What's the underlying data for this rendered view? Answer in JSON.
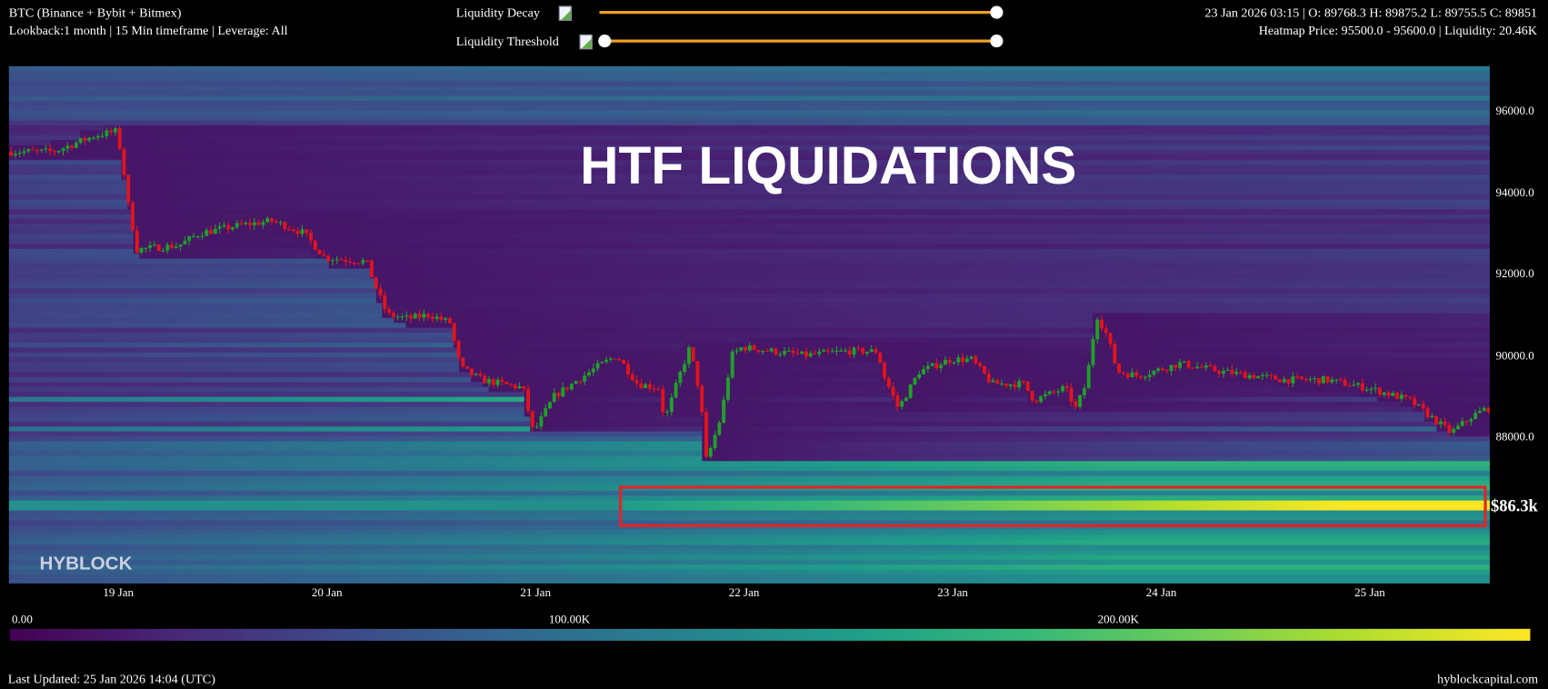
{
  "header": {
    "title": "BTC (Binance + Bybit + Bitmex)",
    "subtitle": "Lookback:1 month | 15 Min timeframe | Leverage: All",
    "ohlc": "23 Jan 2026 03:15 | O: 89768.3 H: 89875.2 L: 89755.5 C: 89851",
    "hover": "Heatmap Price: 95500.0 - 95600.0 | Liquidity: 20.46K"
  },
  "controls": {
    "decay_label": "Liquidity Decay",
    "decay_value": 1.0,
    "threshold_label": "Liquidity Threshold",
    "threshold_value": 0.0,
    "slider_color": "#f0a020"
  },
  "chart_data": {
    "type": "heatmap",
    "title": "HTF LIQUIDATIONS",
    "watermark": "HYBLOCK",
    "yticks": [
      96000,
      94000,
      92000,
      90000,
      88000
    ],
    "ytick_labels": [
      "96000.0",
      "94000.0",
      "92000.0",
      "90000.0",
      "88000.0"
    ],
    "ylim": [
      84400,
      97100
    ],
    "xtick_labels": [
      "19 Jan",
      "20 Jan",
      "21 Jan",
      "22 Jan",
      "23 Jan",
      "24 Jan",
      "25 Jan"
    ],
    "xlim_days_from_19_jan": [
      -0.525,
      6.575
    ],
    "price_path": [
      [
        -0.52,
        95000
      ],
      [
        -0.3,
        95000
      ],
      [
        -0.1,
        95400
      ],
      [
        0,
        95500
      ],
      [
        0.03,
        94800
      ],
      [
        0.05,
        93900
      ],
      [
        0.1,
        92600
      ],
      [
        0.3,
        92700
      ],
      [
        0.4,
        93000
      ],
      [
        0.6,
        93200
      ],
      [
        0.75,
        93300
      ],
      [
        0.9,
        93000
      ],
      [
        1.0,
        92400
      ],
      [
        1.2,
        92300
      ],
      [
        1.25,
        91600
      ],
      [
        1.3,
        91000
      ],
      [
        1.4,
        90900
      ],
      [
        1.5,
        91000
      ],
      [
        1.6,
        90800
      ],
      [
        1.65,
        89700
      ],
      [
        1.75,
        89400
      ],
      [
        1.85,
        89300
      ],
      [
        1.95,
        89200
      ],
      [
        2.0,
        88100
      ],
      [
        2.1,
        89000
      ],
      [
        2.3,
        89700
      ],
      [
        2.4,
        90000
      ],
      [
        2.5,
        89300
      ],
      [
        2.6,
        89200
      ],
      [
        2.63,
        88400
      ],
      [
        2.7,
        89500
      ],
      [
        2.75,
        90200
      ],
      [
        2.8,
        89000
      ],
      [
        2.83,
        87400
      ],
      [
        2.9,
        88500
      ],
      [
        2.95,
        90000
      ],
      [
        3.0,
        90200
      ],
      [
        3.3,
        90000
      ],
      [
        3.5,
        90100
      ],
      [
        3.65,
        90100
      ],
      [
        3.68,
        89500
      ],
      [
        3.75,
        88700
      ],
      [
        3.85,
        89600
      ],
      [
        4.0,
        89900
      ],
      [
        4.1,
        89900
      ],
      [
        4.2,
        89300
      ],
      [
        4.35,
        89300
      ],
      [
        4.4,
        88900
      ],
      [
        4.55,
        89200
      ],
      [
        4.6,
        88700
      ],
      [
        4.65,
        89300
      ],
      [
        4.7,
        91000
      ],
      [
        4.75,
        90500
      ],
      [
        4.8,
        89600
      ],
      [
        4.9,
        89500
      ],
      [
        5.1,
        89800
      ],
      [
        5.3,
        89600
      ],
      [
        5.6,
        89400
      ],
      [
        5.8,
        89400
      ],
      [
        6.0,
        89200
      ],
      [
        6.2,
        88900
      ],
      [
        6.35,
        88300
      ],
      [
        6.4,
        88100
      ],
      [
        6.5,
        88500
      ],
      [
        6.57,
        88700
      ]
    ],
    "highlight": {
      "label": "$86.3k",
      "price": 86300,
      "from_day": 2.4,
      "color": "#e0262a"
    },
    "colorbar": {
      "min": 0,
      "max": 277000,
      "tick_labels": [
        "0.00",
        "100.00K",
        "200.00K"
      ],
      "tick_values": [
        0,
        100000,
        200000
      ],
      "colormap": "viridis"
    },
    "up_color": "#1fa02a",
    "down_color": "#e0141e"
  },
  "footer": {
    "updated": "Last Updated: 25 Jan 2026 14:04 (UTC)",
    "site": "hyblockcapital.com"
  }
}
